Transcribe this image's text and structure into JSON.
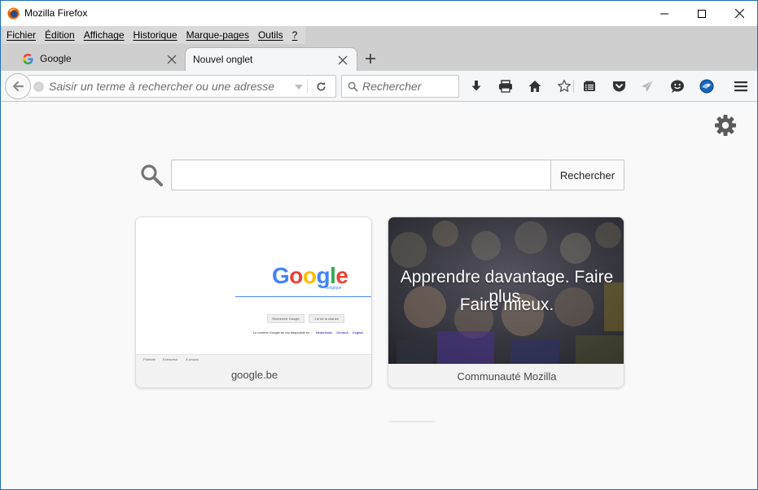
{
  "window": {
    "title": "Mozilla Firefox",
    "accent_border": "#1f6fb8"
  },
  "menubar": {
    "items": [
      "Fichier",
      "Édition",
      "Affichage",
      "Historique",
      "Marque-pages",
      "Outils",
      "?"
    ]
  },
  "tabs": [
    {
      "label": "Google",
      "favicon": "google-g-icon",
      "active": false
    },
    {
      "label": "Nouvel onglet",
      "favicon": "",
      "active": true
    }
  ],
  "navbar": {
    "url_placeholder": "Saisir un terme à rechercher ou une adresse",
    "url_value": "",
    "search_placeholder": "Rechercher",
    "toolbar_icons": [
      "download-icon",
      "print-icon",
      "home-icon",
      "bookmark-star-icon",
      "reading-list-icon",
      "pocket-icon",
      "send-icon",
      "emoji-icon",
      "extension-icon",
      "hamburger-menu-icon"
    ]
  },
  "newtab": {
    "search_value": "",
    "search_button": "Rechercher",
    "tiles": [
      {
        "label": "google.be",
        "preview": {
          "logo": "Google",
          "sublogo": "Belgique",
          "buttons": [
            "Recherche Google",
            "J'ai de la chance"
          ],
          "languages_text": "Le comme Google.be est disponible en :",
          "languages": [
            "Nederlands",
            "Deutsch",
            "English"
          ],
          "footer": [
            "Publicité",
            "Entreprise",
            "À propos"
          ]
        }
      },
      {
        "label": "Communauté Mozilla",
        "preview": {
          "caption_line1": "Apprendre davantage. Faire plus.",
          "caption_line2": "Faire mieux."
        }
      }
    ]
  },
  "colors": {
    "google_blue": "#4285f4",
    "google_red": "#ea4335",
    "google_yellow": "#fbbc05",
    "google_green": "#34a853"
  }
}
